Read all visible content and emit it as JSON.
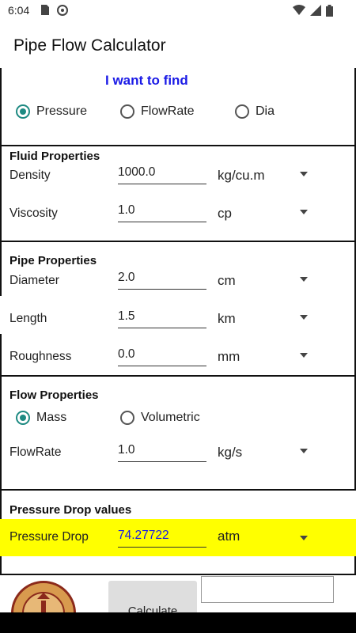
{
  "status_bar": {
    "time": "6:04",
    "icons": [
      "sim-card-icon",
      "sync-icon",
      "wifi-icon",
      "signal-icon",
      "battery-icon"
    ]
  },
  "app": {
    "title": "Pipe Flow Calculator"
  },
  "find": {
    "heading": "I want to find",
    "options": [
      {
        "label": "Pressure",
        "checked": true
      },
      {
        "label": "FlowRate",
        "checked": false
      },
      {
        "label": "Dia",
        "checked": false
      }
    ]
  },
  "fluid": {
    "title": "Fluid Properties",
    "density": {
      "label": "Density",
      "value": "1000.0",
      "unit": "kg/cu.m"
    },
    "viscosity": {
      "label": "Viscosity",
      "value": "1.0",
      "unit": "cp"
    }
  },
  "pipe": {
    "title": "Pipe Properties",
    "diameter": {
      "label": "Diameter",
      "value": "2.0",
      "unit": "cm"
    },
    "length": {
      "label": "Length",
      "value": "1.5",
      "unit": "km"
    },
    "roughness": {
      "label": "Roughness",
      "value": "0.0",
      "unit": "mm"
    }
  },
  "flow": {
    "title": "Flow Properties",
    "modes": [
      {
        "label": "Mass",
        "checked": true
      },
      {
        "label": "Volumetric",
        "checked": false
      }
    ],
    "flowrate": {
      "label": "FlowRate",
      "value": "1.0",
      "unit": "kg/s"
    }
  },
  "pressure_drop": {
    "title": "Pressure Drop values",
    "label": "Pressure Drop",
    "value": "74.27722",
    "unit": "atm",
    "highlight_color": "#ffff00"
  },
  "actions": {
    "calculate_label": "Calculate"
  },
  "colors": {
    "accent": "#1e8a82",
    "heading_blue": "#1a1ae6"
  }
}
